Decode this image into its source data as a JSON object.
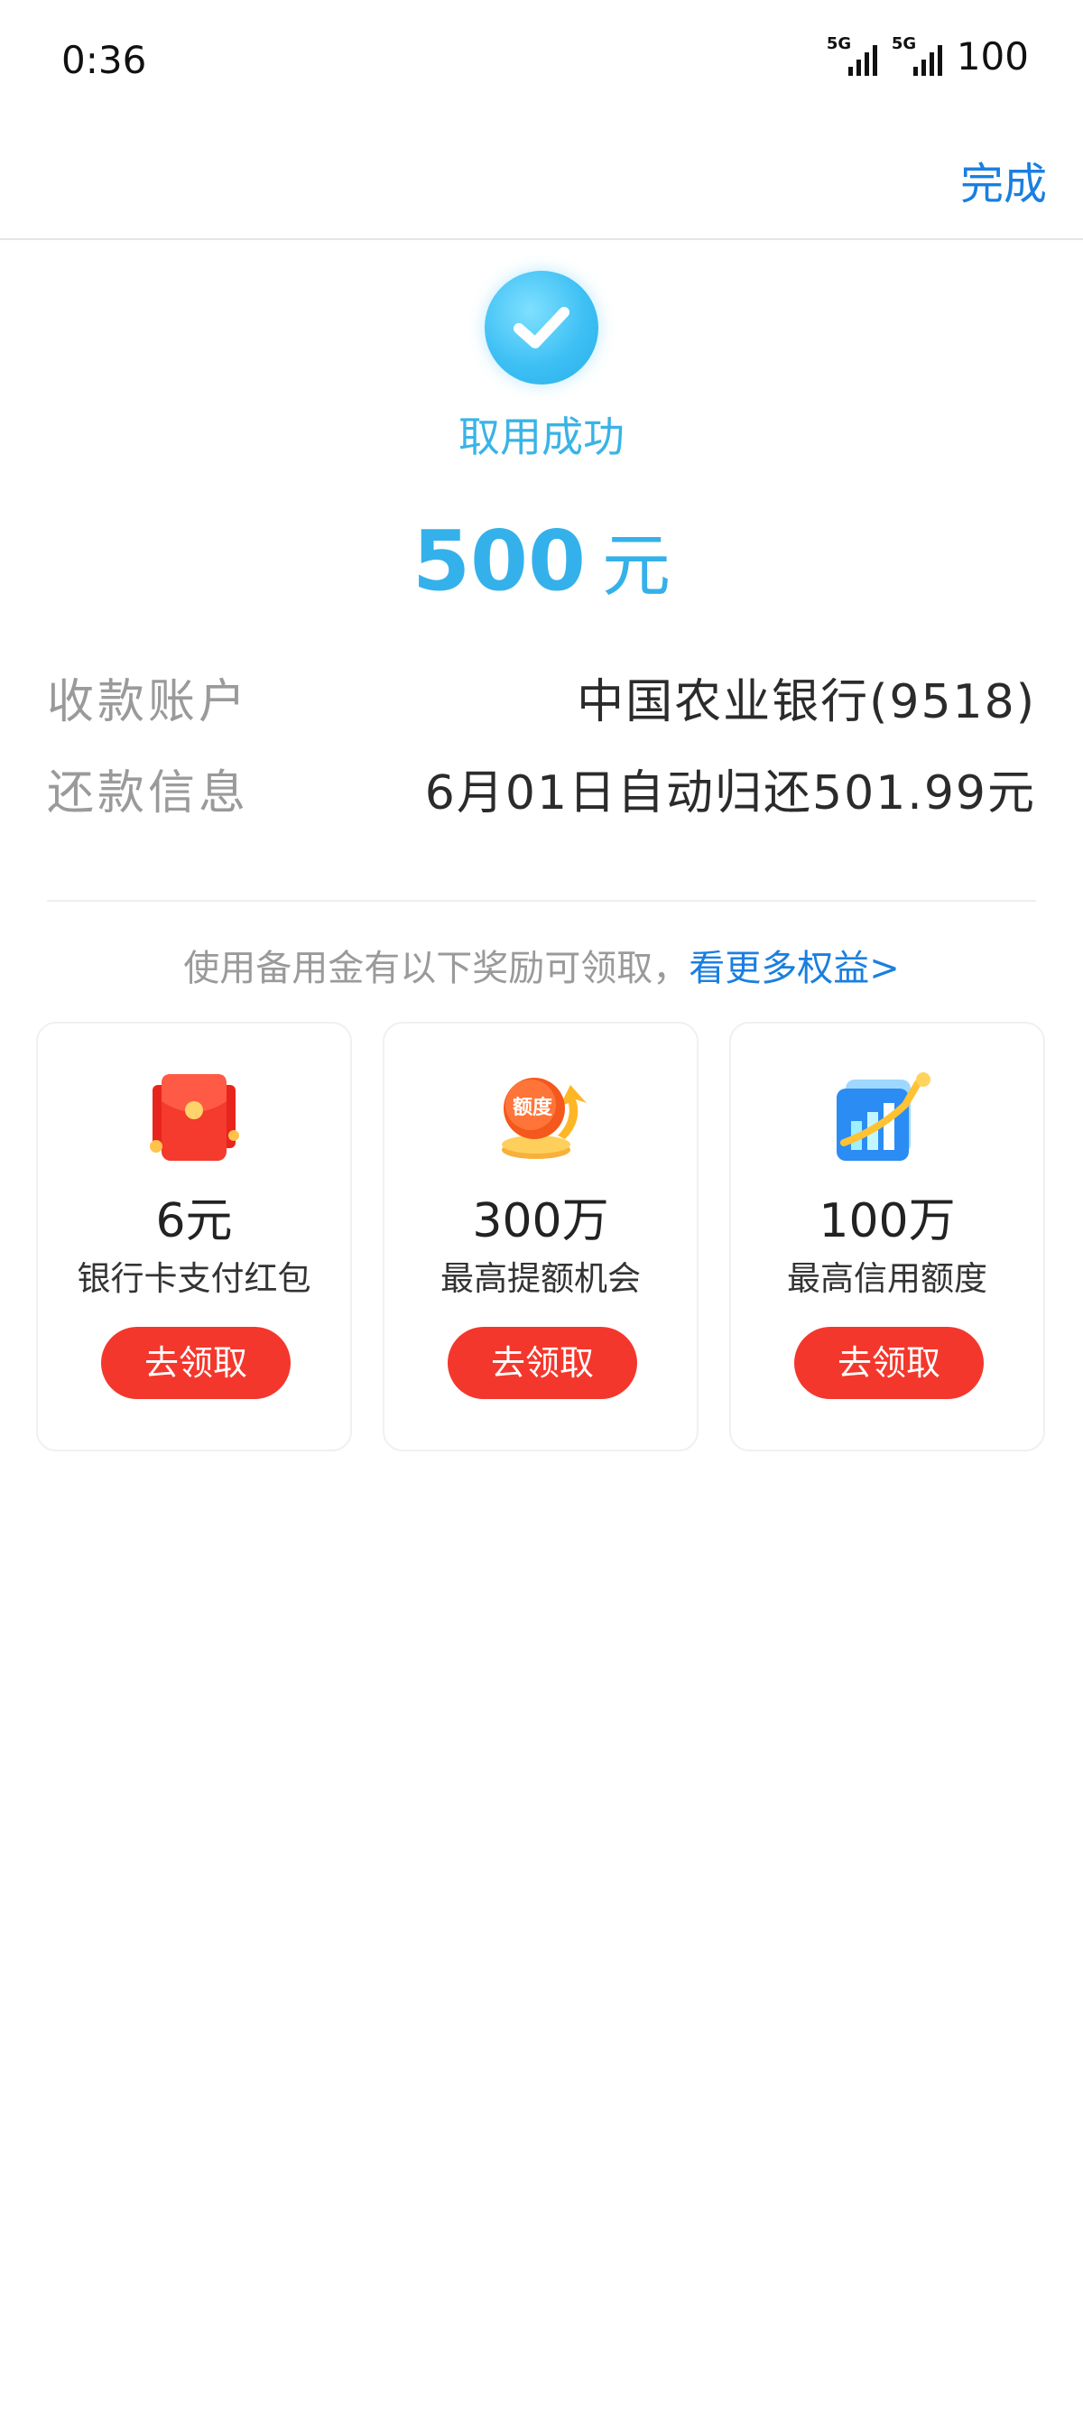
{
  "status_bar": {
    "time": "0:36",
    "network1": "5G",
    "network2": "5G",
    "battery": "100"
  },
  "header": {
    "done_label": "完成"
  },
  "result": {
    "status_text": "取用成功",
    "amount": "500",
    "unit": "元"
  },
  "info": {
    "account_label": "收款账户",
    "account_value": "中国农业银行(9518)",
    "repay_label": "还款信息",
    "repay_value": "6月01日自动归还501.99元"
  },
  "promo": {
    "text": "使用备用金有以下奖励可领取，",
    "link": "看更多权益>"
  },
  "cards": [
    {
      "icon": "red-envelope-icon",
      "value": "6元",
      "desc": "银行卡支付红包",
      "button": "去领取"
    },
    {
      "icon": "credit-limit-coin-icon",
      "icon_text": "额度",
      "value": "300万",
      "desc": "最高提额机会",
      "button": "去领取"
    },
    {
      "icon": "growth-chart-icon",
      "value": "100万",
      "desc": "最高信用额度",
      "button": "去领取"
    }
  ],
  "colors": {
    "accent_blue": "#34b1ea",
    "link_blue": "#1a7fe0",
    "button_red": "#f4372c"
  }
}
